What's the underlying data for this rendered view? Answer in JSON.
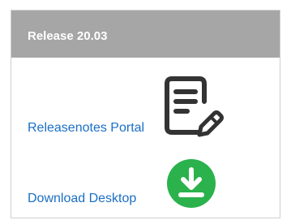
{
  "card": {
    "title": "Release 20.03"
  },
  "links": {
    "release_notes": "Releasenotes Portal",
    "download_desktop": "Download Desktop"
  },
  "icons": {
    "notes": "document-edit-icon",
    "download": "download-icon"
  },
  "colors": {
    "header_bg": "#a6a6a6",
    "link": "#1a6fc4",
    "download_circle": "#2bb24c",
    "notes_icon": "#333333"
  }
}
